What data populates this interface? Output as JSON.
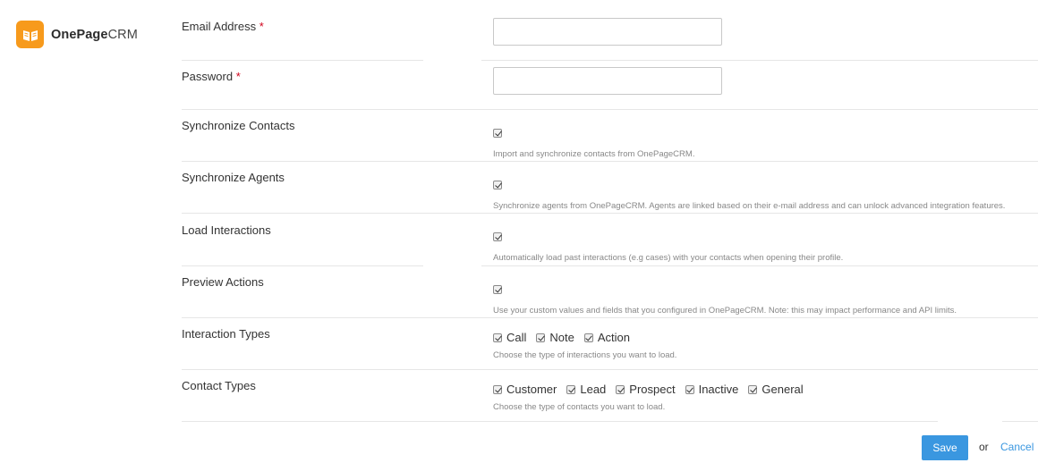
{
  "brand": {
    "bold": "OnePage",
    "light": "CRM",
    "accent": "#f79a1c"
  },
  "fields": {
    "email": {
      "label": "Email Address",
      "required": "*",
      "value": "",
      "placeholder": ""
    },
    "password": {
      "label": "Password",
      "required": "*",
      "value": "",
      "placeholder": ""
    }
  },
  "settings": {
    "sync_contacts": {
      "label": "Synchronize Contacts",
      "checked": true,
      "help": "Import and synchronize contacts from OnePageCRM."
    },
    "sync_agents": {
      "label": "Synchronize Agents",
      "checked": true,
      "help": "Synchronize agents from OnePageCRM. Agents are linked based on their e-mail address and can unlock advanced integration features."
    },
    "load_interactions": {
      "label": "Load Interactions",
      "checked": true,
      "help": "Automatically load past interactions (e.g cases) with your contacts when opening their profile."
    },
    "preview_actions": {
      "label": "Preview Actions",
      "checked": true,
      "help": "Use your custom values and fields that you configured in OnePageCRM. Note: this may impact performance and API limits."
    }
  },
  "interaction_types": {
    "label": "Interaction Types",
    "options": [
      "Call",
      "Note",
      "Action"
    ],
    "help": "Choose the type of interactions you want to load."
  },
  "contact_types": {
    "label": "Contact Types",
    "options": [
      "Customer",
      "Lead",
      "Prospect",
      "Inactive",
      "General"
    ],
    "help": "Choose the type of contacts you want to load."
  },
  "actions": {
    "save": "Save",
    "or": "or",
    "cancel": "Cancel",
    "primary_color": "#3a97e0"
  }
}
